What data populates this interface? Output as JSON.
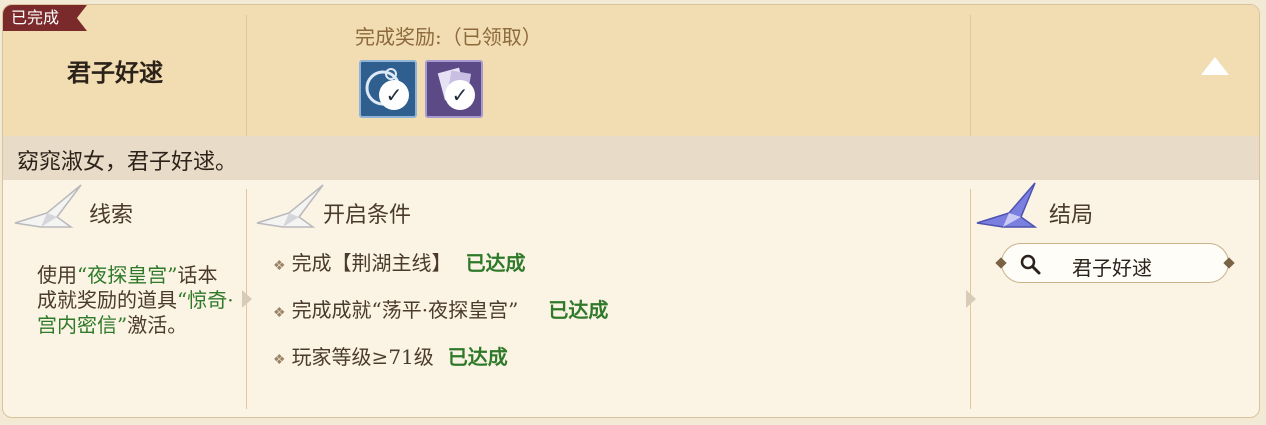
{
  "status_badge": "已完成",
  "quest": {
    "title": "君子好逑",
    "quote": "窈窕淑女，君子好逑。"
  },
  "reward": {
    "title": "完成奖励:（已领取）",
    "items": [
      {
        "icon": "scroll-token-icon",
        "color": "#2f5f8f",
        "claimed": true
      },
      {
        "icon": "secret-letter-icon",
        "color": "#5b4a86",
        "claimed": true
      }
    ]
  },
  "clue": {
    "heading": "线索",
    "text_parts": [
      "使用",
      "“夜探皇宫”",
      "话本成就奖励的道具",
      "“惊奇·宫内密信”",
      "激活。"
    ]
  },
  "conditions": {
    "heading": "开启条件",
    "items": [
      {
        "text": "完成【荆湖主线】",
        "status": "已达成"
      },
      {
        "text": "完成成就“荡平·夜探皇宫”",
        "status": "已达成"
      },
      {
        "text": "玩家等级≥71级",
        "status": "已达成"
      }
    ]
  },
  "ending": {
    "heading": "结局",
    "value": "君子好逑"
  },
  "colors": {
    "header_bg": "#f2dcb2",
    "badge": "#7b2a2c",
    "achieved_green": "#2f7a2a",
    "ending_crane": "#6a6fd8"
  }
}
